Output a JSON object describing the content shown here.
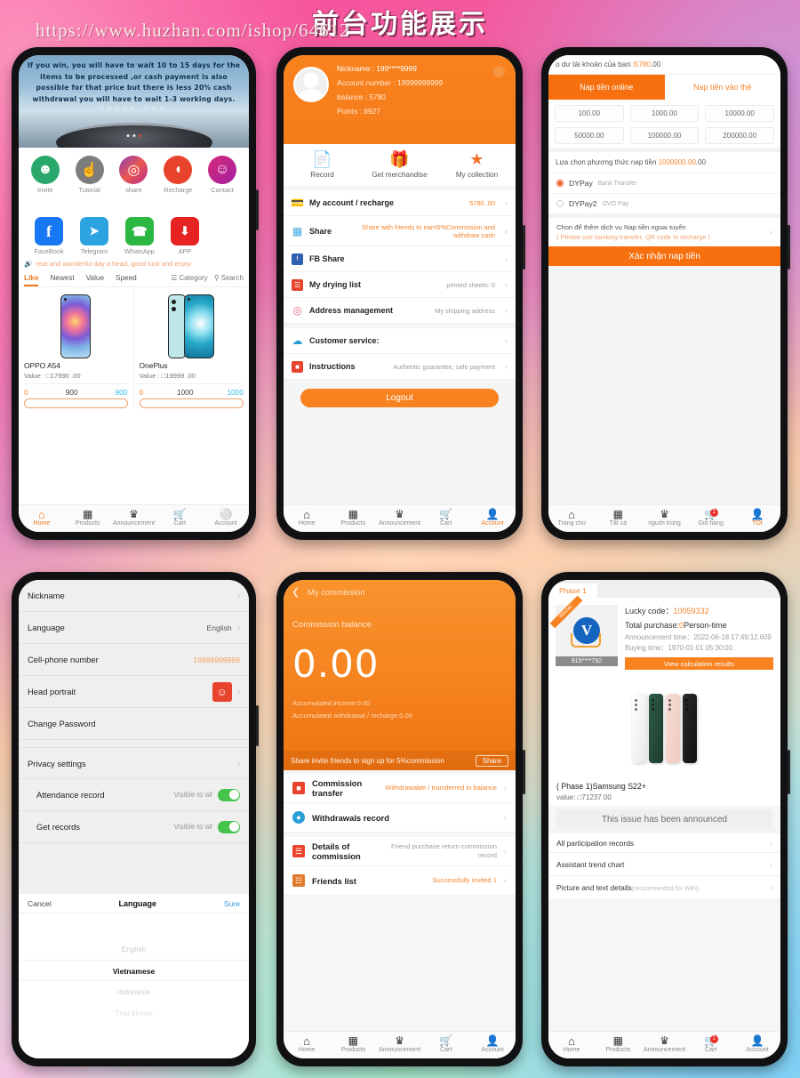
{
  "banner": {
    "title": "前台功能展示",
    "url": "https://www.huzhan.com/ishop/64612"
  },
  "phone1_home": {
    "hero_text": "If you win, you will have to wait 10 to 15 days for the items to be processed ,or cash payment is also possible for that price but there is less 20% cash withdrawal you will have to wait 1-3 working days.",
    "hero_thanks": "THANK YOU",
    "icons_row1": [
      {
        "label": "Invite",
        "icon": "group-icon",
        "glyph": "⚇"
      },
      {
        "label": "Tutorial",
        "icon": "hand-pointer-icon",
        "glyph": "☝"
      },
      {
        "label": "share",
        "icon": "camera-icon",
        "glyph": "◎"
      },
      {
        "label": "Recharge",
        "icon": "wallet-icon",
        "glyph": "◖"
      },
      {
        "label": "Contact",
        "icon": "customer-support-icon",
        "glyph": "☺"
      }
    ],
    "icons_row2": [
      {
        "label": "FaceBook",
        "icon": "facebook-icon",
        "glyph": "f"
      },
      {
        "label": "Telegram",
        "icon": "telegram-icon",
        "glyph": "➤"
      },
      {
        "label": "WhatsApp",
        "icon": "whatsapp-icon",
        "glyph": "✆"
      },
      {
        "label": "APP",
        "icon": "download-icon",
        "glyph": "⬇"
      }
    ],
    "notice": "reat and wonderful day a head, good luck and enjoy",
    "notice_icon": "speaker-icon",
    "tabs": [
      "Like",
      "Newest",
      "Value",
      "Speed"
    ],
    "category_label": "Category",
    "search_label": "Search",
    "products": [
      {
        "name": "OPPO A54",
        "value": "Value : □17990 .00",
        "c0": "0",
        "c1": "900",
        "c2": "900"
      },
      {
        "name": "OnePlus",
        "value": "Value : □19999 .00",
        "c0": "0",
        "c1": "1000",
        "c2": "1000"
      }
    ],
    "nav": [
      {
        "label": "Home",
        "icon": "home-icon",
        "active": true
      },
      {
        "label": "Products",
        "icon": "grid-icon",
        "active": false
      },
      {
        "label": "Announcement",
        "icon": "trophy-icon",
        "active": false
      },
      {
        "label": "Cart",
        "icon": "cart-icon",
        "active": false
      },
      {
        "label": "Account",
        "icon": "person-icon",
        "active": false
      }
    ]
  },
  "phone2_account": {
    "nickname": "Nickname : 199****9999",
    "account_number": "Account number :   19999999999",
    "balance": "balance : 5780",
    "points": "Points : 8927",
    "quick": [
      {
        "label": "Record",
        "icon": "document-icon",
        "glyph": "📄"
      },
      {
        "label": "Get merchandise",
        "icon": "gift-icon",
        "glyph": "🎁"
      },
      {
        "label": "My collection",
        "icon": "star-icon",
        "glyph": "★"
      }
    ],
    "rows": [
      {
        "label": "My account / recharge",
        "sub": "5780 .00",
        "orange": true,
        "icon": "wallet-icon"
      },
      {
        "label": "Share",
        "sub": "Share with friends to earn5%Commission and withdraw cash",
        "orange": true,
        "icon": "qrcode-icon"
      },
      {
        "label": "FB Share",
        "sub": "",
        "orange": false,
        "icon": "facebook-icon"
      },
      {
        "label": "My drying list",
        "sub": "printed sheets: 0",
        "orange": false,
        "icon": "list-icon"
      },
      {
        "label": "Address management",
        "sub": "My shipping address",
        "orange": false,
        "icon": "location-pin-icon"
      },
      {
        "label": "Customer service:",
        "sub": "",
        "orange": false,
        "icon": "headset-icon"
      },
      {
        "label": "Instructions",
        "sub": "Authentic guarantee, safe payment",
        "orange": false,
        "icon": "book-icon"
      }
    ],
    "logout": "Logout",
    "nav": [
      {
        "label": "Home",
        "icon": "home-icon",
        "active": false
      },
      {
        "label": "Products",
        "icon": "grid-icon",
        "active": false
      },
      {
        "label": "Announcement",
        "icon": "trophy-icon",
        "active": false
      },
      {
        "label": "Cart",
        "icon": "cart-icon",
        "active": false
      },
      {
        "label": "Account",
        "icon": "person-icon",
        "active": true
      }
    ]
  },
  "phone3_recharge": {
    "balance_prefix": "o dư tài khoản của ban",
    "balance_value": "□5780",
    "balance_suffix": ".00",
    "tabs": [
      {
        "label": "Nap tiền online",
        "active": true
      },
      {
        "label": "Nap tiền vào thẻ",
        "active": false
      }
    ],
    "amounts": [
      "100.00",
      "1000.00",
      "10000.00",
      "50000.00",
      "100000.00",
      "200000.00"
    ],
    "method_label": "Lựa chọn phương thức nap tiền ",
    "method_value": "1000000.00",
    "method_suffix": ".00",
    "methods": [
      {
        "name": "DYPay",
        "desc": "Bank Transfer",
        "selected": true
      },
      {
        "name": "DYPay2",
        "desc": "OVO Pay",
        "selected": false
      }
    ],
    "offline_line1": "Chon để thêm dịch vụ Nap tiền ngoai tuyến",
    "offline_line2": "( Please use banking transfer, QR code to recharge )",
    "confirm": "Xác nhận nap tiền",
    "nav": [
      {
        "label": "Trang chủ",
        "icon": "home-icon",
        "active": false
      },
      {
        "label": "Tất cả",
        "icon": "grid-icon",
        "active": false
      },
      {
        "label": "người trúng",
        "icon": "trophy-icon",
        "active": false
      },
      {
        "label": "Giỏ hàng",
        "icon": "cart-icon",
        "active": false,
        "badge": "1"
      },
      {
        "label": "TÔI",
        "icon": "person-icon",
        "active": true
      }
    ]
  },
  "phone4_settings": {
    "rows": [
      {
        "label": "Nickname",
        "value": "",
        "type": "chevron"
      },
      {
        "label": "Language",
        "value": "English",
        "type": "chevron"
      },
      {
        "label": "Cell-phone number",
        "value": "19999999999",
        "type": "orange"
      },
      {
        "label": "Head portrait",
        "value": "",
        "type": "avatar"
      },
      {
        "label": "Change Password",
        "value": "",
        "type": "plain"
      },
      {
        "label": "Privacy settings",
        "value": "",
        "type": "chevron-gap"
      }
    ],
    "toggles": [
      {
        "label": "Attendance record",
        "value": "Visible to all",
        "on": true
      },
      {
        "label": "Get records",
        "value": "Visible to all",
        "on": true
      }
    ],
    "picker": {
      "cancel": "Cancel",
      "title": "Language",
      "sure": "Sure",
      "options": [
        "English",
        "Vietnamese",
        "Indonesia",
        "Thai khmer"
      ],
      "selected_index": 1
    }
  },
  "phone5_commission": {
    "title": "My commission",
    "back_icon": "chevron-left-icon",
    "balance_label": "Commission balance",
    "balance_value": "0.00",
    "accumulated_income": "Accumulated income:0.00",
    "accumulated_withdrawal": "Accumulated withdrawal / recharge:0.00",
    "share_text": "Share invite friends to sign up for 5%commission",
    "share_button": "Share",
    "rows": [
      {
        "label": "Commission transfer",
        "sub": "Withdrawable / transferred in balance",
        "orange": true,
        "icon": "book-icon",
        "color": "#e8432c"
      },
      {
        "label": "Withdrawals record",
        "sub": "",
        "orange": false,
        "icon": "clock-icon",
        "color": "#2a9fd6"
      },
      {
        "label": "Details of commission",
        "sub": "Friend purchase return commission record",
        "orange": false,
        "icon": "table-icon",
        "color": "#e8432c"
      },
      {
        "label": "Friends list",
        "sub": "Successfully invited 1",
        "orange": true,
        "icon": "contacts-icon",
        "color": "#e07a2c"
      }
    ],
    "nav": [
      {
        "label": "Home",
        "icon": "home-icon",
        "active": false
      },
      {
        "label": "Products",
        "icon": "grid-icon",
        "active": false
      },
      {
        "label": "Announcement",
        "icon": "trophy-icon",
        "active": false
      },
      {
        "label": "Cart",
        "icon": "cart-icon",
        "active": false
      },
      {
        "label": "Account",
        "icon": "person-icon",
        "active": false
      }
    ]
  },
  "phone6_lottery": {
    "phase_tab": "Phase 1",
    "ribbon": "Winner",
    "winner_id": "915****792",
    "lucky_code_label": "Lucky code：",
    "lucky_code_value": "10059332",
    "total_purchase_label": "Total purchase:",
    "total_purchase_value": "0",
    "total_purchase_unit": "Person-time",
    "announcement_time": "Announcement time：2022-06-18 17:49:12.609",
    "buying_time": "Buying time：1970-01-01 05:30:00.",
    "view_button": "View calculation results",
    "product_name": "( Phase 1)Samsung S22+",
    "product_value": "value: □71237  00",
    "announced": "This issue has been announced",
    "rows": [
      {
        "label": "All participation records",
        "note": ""
      },
      {
        "label": "Assistant trend chart",
        "note": ""
      },
      {
        "label": "Picture and text details",
        "note": "(recommended for WiFi)"
      }
    ],
    "nav": [
      {
        "label": "Home",
        "icon": "home-icon",
        "active": false
      },
      {
        "label": "Products",
        "icon": "grid-icon",
        "active": false
      },
      {
        "label": "Announcement",
        "icon": "trophy-icon",
        "active": false
      },
      {
        "label": "Cart",
        "icon": "cart-icon",
        "active": false,
        "badge": "1"
      },
      {
        "label": "Account",
        "icon": "person-icon",
        "active": false
      }
    ]
  }
}
